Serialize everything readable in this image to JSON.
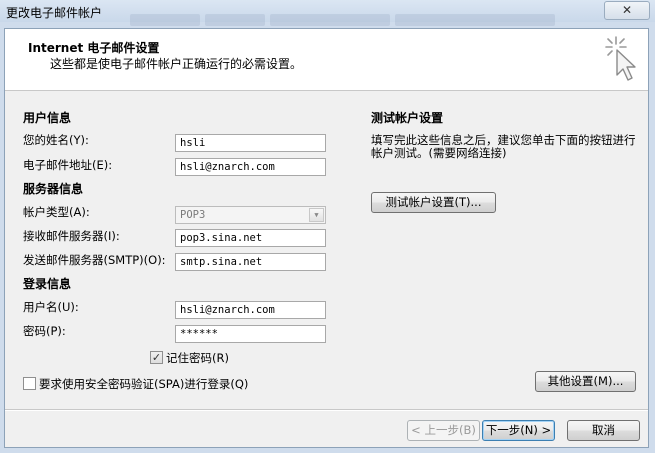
{
  "window": {
    "title": "更改电子邮件帐户",
    "close_glyph": "✕"
  },
  "header": {
    "title": "Internet 电子邮件设置",
    "subtitle": "这些都是使电子邮件帐户正确运行的必需设置。"
  },
  "user_info": {
    "section": "用户信息",
    "name_label": "您的姓名(Y):",
    "name_value": "hsli",
    "email_label": "电子邮件地址(E):",
    "email_value": "hsli@znarch.com"
  },
  "server_info": {
    "section": "服务器信息",
    "account_type_label": "帐户类型(A):",
    "account_type_value": "POP3",
    "incoming_label": "接收邮件服务器(I):",
    "incoming_value": "pop3.sina.net",
    "outgoing_label": "发送邮件服务器(SMTP)(O):",
    "outgoing_value": "smtp.sina.net"
  },
  "login_info": {
    "section": "登录信息",
    "username_label": "用户名(U):",
    "username_value": "hsli@znarch.com",
    "password_label": "密码(P):",
    "password_value": "******",
    "remember_label": "记住密码(R)",
    "remember_checked": true,
    "spa_label": "要求使用安全密码验证(SPA)进行登录(Q)",
    "spa_checked": false
  },
  "test": {
    "section": "测试帐户设置",
    "description": "填写完此这些信息之后，建议您单击下面的按钮进行帐户测试。(需要网络连接)",
    "button": "测试帐户设置(T)..."
  },
  "buttons": {
    "more_settings": "其他设置(M)...",
    "back": "< 上一步(B)",
    "next": "下一步(N) >",
    "cancel": "取消"
  },
  "icons": {
    "header_icon": "cursor-click-icon",
    "check_glyph": "✓",
    "dropdown_glyph": "▼"
  }
}
